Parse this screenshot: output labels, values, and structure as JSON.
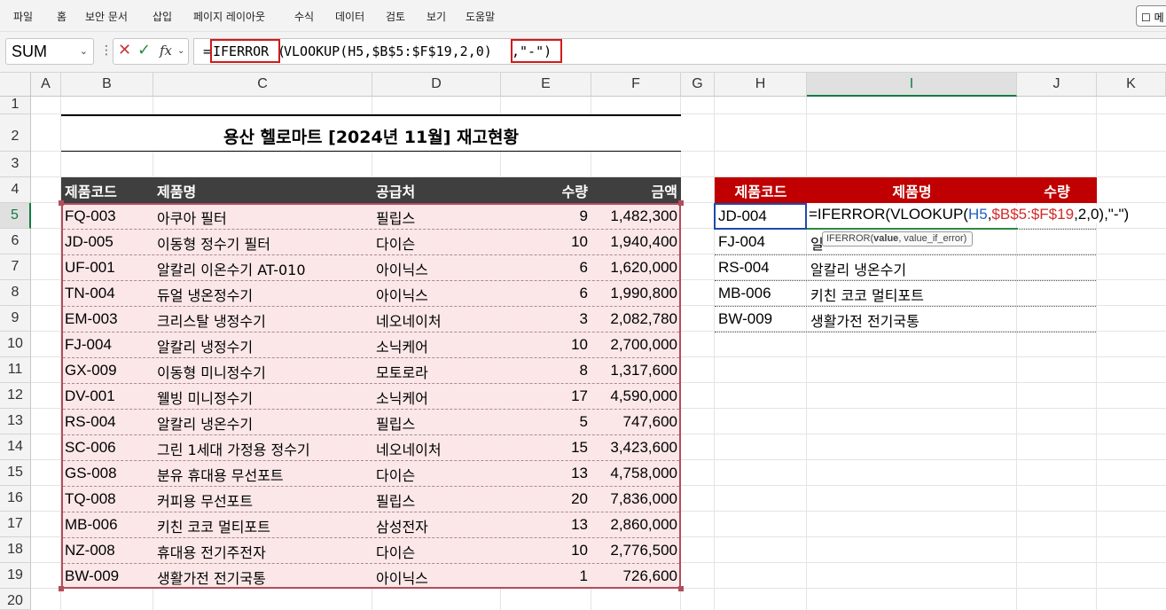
{
  "menu": [
    "파일",
    "홈",
    "보안 문서",
    "삽입",
    "페이지 레이아웃",
    "수식",
    "데이터",
    "검토",
    "보기",
    "도움말"
  ],
  "comment_button": "메",
  "formula_bar": {
    "name_box": "SUM",
    "fx": "fx",
    "segments": [
      "=",
      "IFERROR",
      "(",
      "VLOOKUP(H5,$B$5:$F$19,2,0)",
      ",\"-\")"
    ]
  },
  "columns": [
    "A",
    "B",
    "C",
    "D",
    "E",
    "F",
    "G",
    "H",
    "I",
    "J",
    "K"
  ],
  "rows": [
    "1",
    "2",
    "3",
    "4",
    "5",
    "6",
    "7",
    "8",
    "9",
    "10",
    "11",
    "12",
    "13",
    "14",
    "15",
    "16",
    "17",
    "18",
    "19",
    "20"
  ],
  "sheet": {
    "title": "용산 헬로마트 [2024년 11월] 재고현황",
    "headers": [
      "제품코드",
      "제품명",
      "공급처",
      "수량",
      "금액"
    ],
    "rows": [
      [
        "FQ-003",
        "아쿠아 필터",
        "필립스",
        "9",
        "1,482,300"
      ],
      [
        "JD-005",
        "이동형 정수기 필터",
        "다이슨",
        "10",
        "1,940,400"
      ],
      [
        "UF-001",
        "알칼리 이온수기 AT-010",
        "아이닉스",
        "6",
        "1,620,000"
      ],
      [
        "TN-004",
        "듀얼 냉온정수기",
        "아이닉스",
        "6",
        "1,990,800"
      ],
      [
        "EM-003",
        "크리스탈 냉정수기",
        "네오네이처",
        "3",
        "2,082,780"
      ],
      [
        "FJ-004",
        "알칼리 냉정수기",
        "소닉케어",
        "10",
        "2,700,000"
      ],
      [
        "GX-009",
        "이동형 미니정수기",
        "모토로라",
        "8",
        "1,317,600"
      ],
      [
        "DV-001",
        "웰빙 미니정수기",
        "소닉케어",
        "17",
        "4,590,000"
      ],
      [
        "RS-004",
        "알칼리 냉온수기",
        "필립스",
        "5",
        "747,600"
      ],
      [
        "SC-006",
        "그린 1세대 가정용 정수기",
        "네오네이처",
        "15",
        "3,423,600"
      ],
      [
        "GS-008",
        "분유 휴대용 무선포트",
        "다이슨",
        "13",
        "4,758,000"
      ],
      [
        "TQ-008",
        "커피용 무선포트",
        "필립스",
        "20",
        "7,836,000"
      ],
      [
        "MB-006",
        "키친 코코 멀티포트",
        "삼성전자",
        "13",
        "2,860,000"
      ],
      [
        "NZ-008",
        "휴대용 전기주전자",
        "다이슨",
        "10",
        "2,776,500"
      ],
      [
        "BW-009",
        "생활가전 전기국통",
        "아이닉스",
        "1",
        "726,600"
      ]
    ]
  },
  "lookup": {
    "headers": [
      "제품코드",
      "제품명",
      "수량"
    ],
    "rows": [
      [
        "JD-004",
        ""
      ],
      [
        "FJ-004",
        "일"
      ],
      [
        "RS-004",
        "알칼리 냉온수기"
      ],
      [
        "MB-006",
        "키친 코코 멀티포트"
      ],
      [
        "BW-009",
        "생활가전 전기국통"
      ]
    ],
    "in_cell_formula": {
      "p1": "=IFERROR(VLOOKUP(",
      "p2": "H5",
      "p3": ",",
      "p4": "$B$5:$F$19",
      "p5": ",2,0),\"-\")"
    },
    "tooltip": {
      "fn": "IFERROR(",
      "arg1": "value",
      "rest": ", value_if_error)"
    }
  }
}
